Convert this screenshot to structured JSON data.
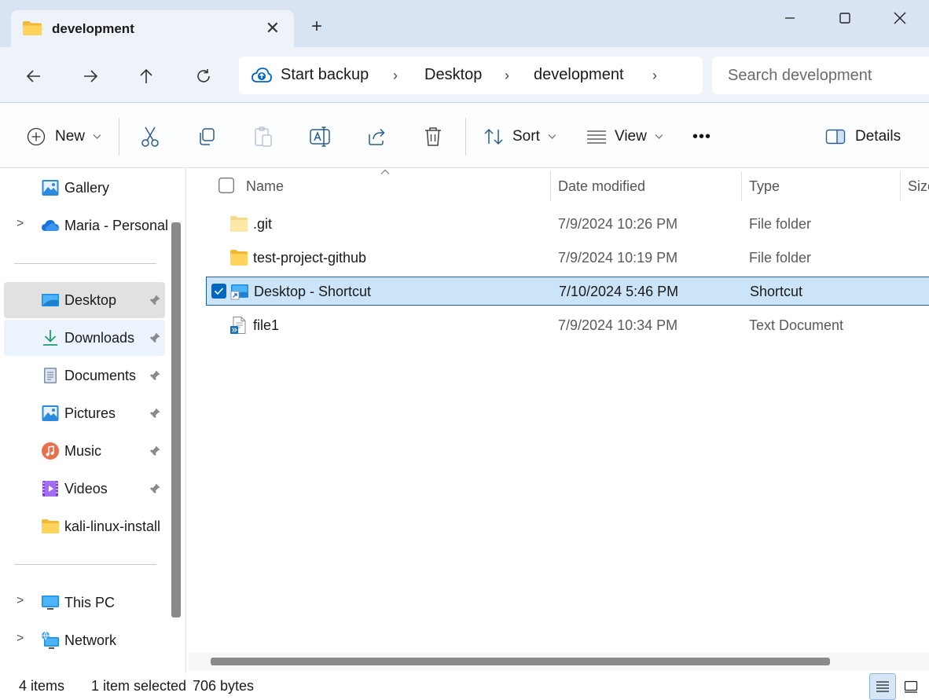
{
  "window": {
    "tab_title": "development",
    "close_tab_symbol": "✕",
    "new_tab_symbol": "+"
  },
  "nav": {
    "breadcrumbs": [
      "Start backup",
      "Desktop",
      "development"
    ],
    "search_placeholder": "Search development"
  },
  "toolbar": {
    "new_label": "New",
    "sort_label": "Sort",
    "view_label": "View",
    "more_label": "•••",
    "details_label": "Details"
  },
  "sidebar": {
    "items": [
      {
        "label": "Gallery",
        "icon": "gallery-icon"
      },
      {
        "label": "Maria - Personal",
        "icon": "onedrive-icon"
      },
      {
        "label": "Desktop",
        "icon": "desktop-icon",
        "pinned": true
      },
      {
        "label": "Downloads",
        "icon": "downloads-icon",
        "pinned": true
      },
      {
        "label": "Documents",
        "icon": "documents-icon",
        "pinned": true
      },
      {
        "label": "Pictures",
        "icon": "pictures-icon",
        "pinned": true
      },
      {
        "label": "Music",
        "icon": "music-icon",
        "pinned": true
      },
      {
        "label": "Videos",
        "icon": "videos-icon",
        "pinned": true
      },
      {
        "label": "kali-linux-install",
        "icon": "folder-icon"
      },
      {
        "label": "This PC",
        "icon": "this-pc-icon"
      },
      {
        "label": "Network",
        "icon": "network-icon"
      }
    ]
  },
  "filelist": {
    "columns": {
      "name": "Name",
      "date": "Date modified",
      "type": "Type",
      "size": "Size"
    },
    "rows": [
      {
        "name": ".git",
        "date": "7/9/2024 10:26 PM",
        "type": "File folder",
        "icon": "folder-light-icon"
      },
      {
        "name": "test-project-github",
        "date": "7/9/2024 10:19 PM",
        "type": "File folder",
        "icon": "folder-icon"
      },
      {
        "name": "Desktop - Shortcut",
        "date": "7/10/2024 5:46 PM",
        "type": "Shortcut",
        "icon": "shortcut-icon",
        "selected": true
      },
      {
        "name": "file1",
        "date": "7/9/2024 10:34 PM",
        "type": "Text Document",
        "icon": "text-document-icon"
      }
    ]
  },
  "status": {
    "item_count": "4 items",
    "selection": "1 item selected",
    "size": "706 bytes"
  },
  "colors": {
    "titlebar": "#d8e4f3",
    "navbar": "#eef3fa",
    "selection": "#cce4f7",
    "accent": "#0067c0",
    "folder": "#f7c948"
  }
}
